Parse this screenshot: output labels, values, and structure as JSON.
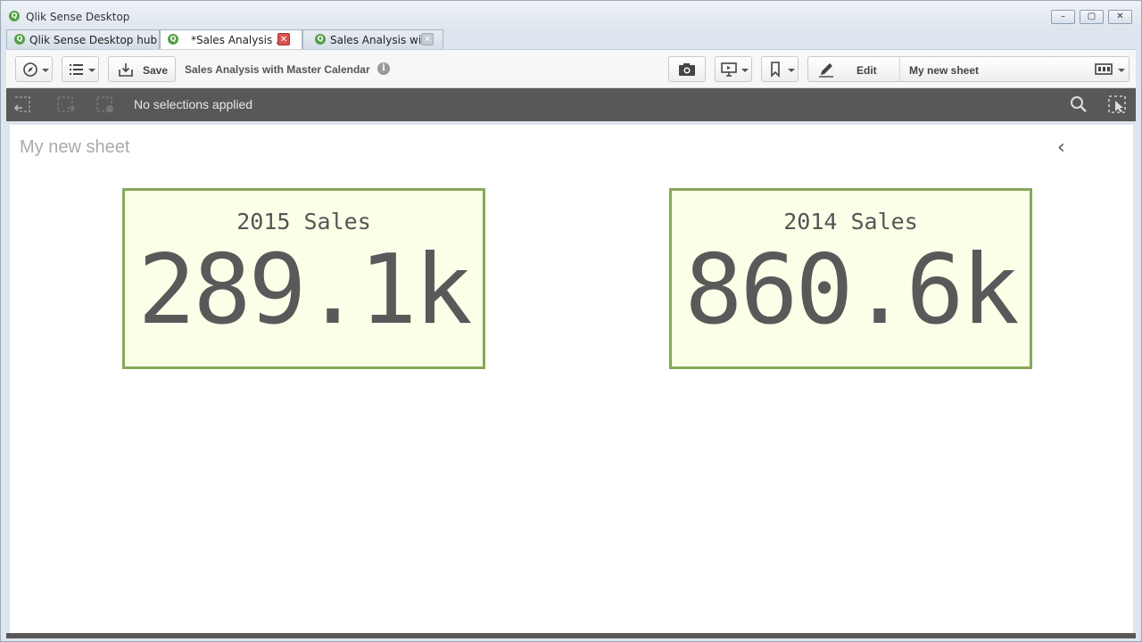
{
  "window": {
    "title": "Qlik Sense Desktop",
    "logo_glyph": "Q",
    "minimize": "–",
    "maximize": "▢",
    "close": "✕"
  },
  "tabs": [
    {
      "label": "Qlik Sense Desktop hub",
      "active": false,
      "closable": false
    },
    {
      "label": "*Sales Analysis ...",
      "active": true,
      "closable": true,
      "close_glyph": "✕"
    },
    {
      "label": "Sales Analysis wi...",
      "active": false,
      "closable": true,
      "close_glyph": "✕"
    }
  ],
  "toolbar": {
    "save_label": "Save",
    "app_name": "Sales Analysis with Master Calendar",
    "info_glyph": "i",
    "edit_label": "Edit",
    "sheet_name": "My new sheet"
  },
  "selections": {
    "status": "No selections applied"
  },
  "sheet": {
    "title": "My new sheet",
    "collapse_glyph": "‹",
    "kpis": [
      {
        "title": "2015 Sales",
        "value": "289.1k"
      },
      {
        "title": "2014 Sales",
        "value": "860.6k"
      }
    ]
  },
  "colors": {
    "kpi_border": "#87a859",
    "kpi_background": "#fbffe8",
    "selection_bar": "#585858",
    "qlik_green": "#55a046"
  }
}
